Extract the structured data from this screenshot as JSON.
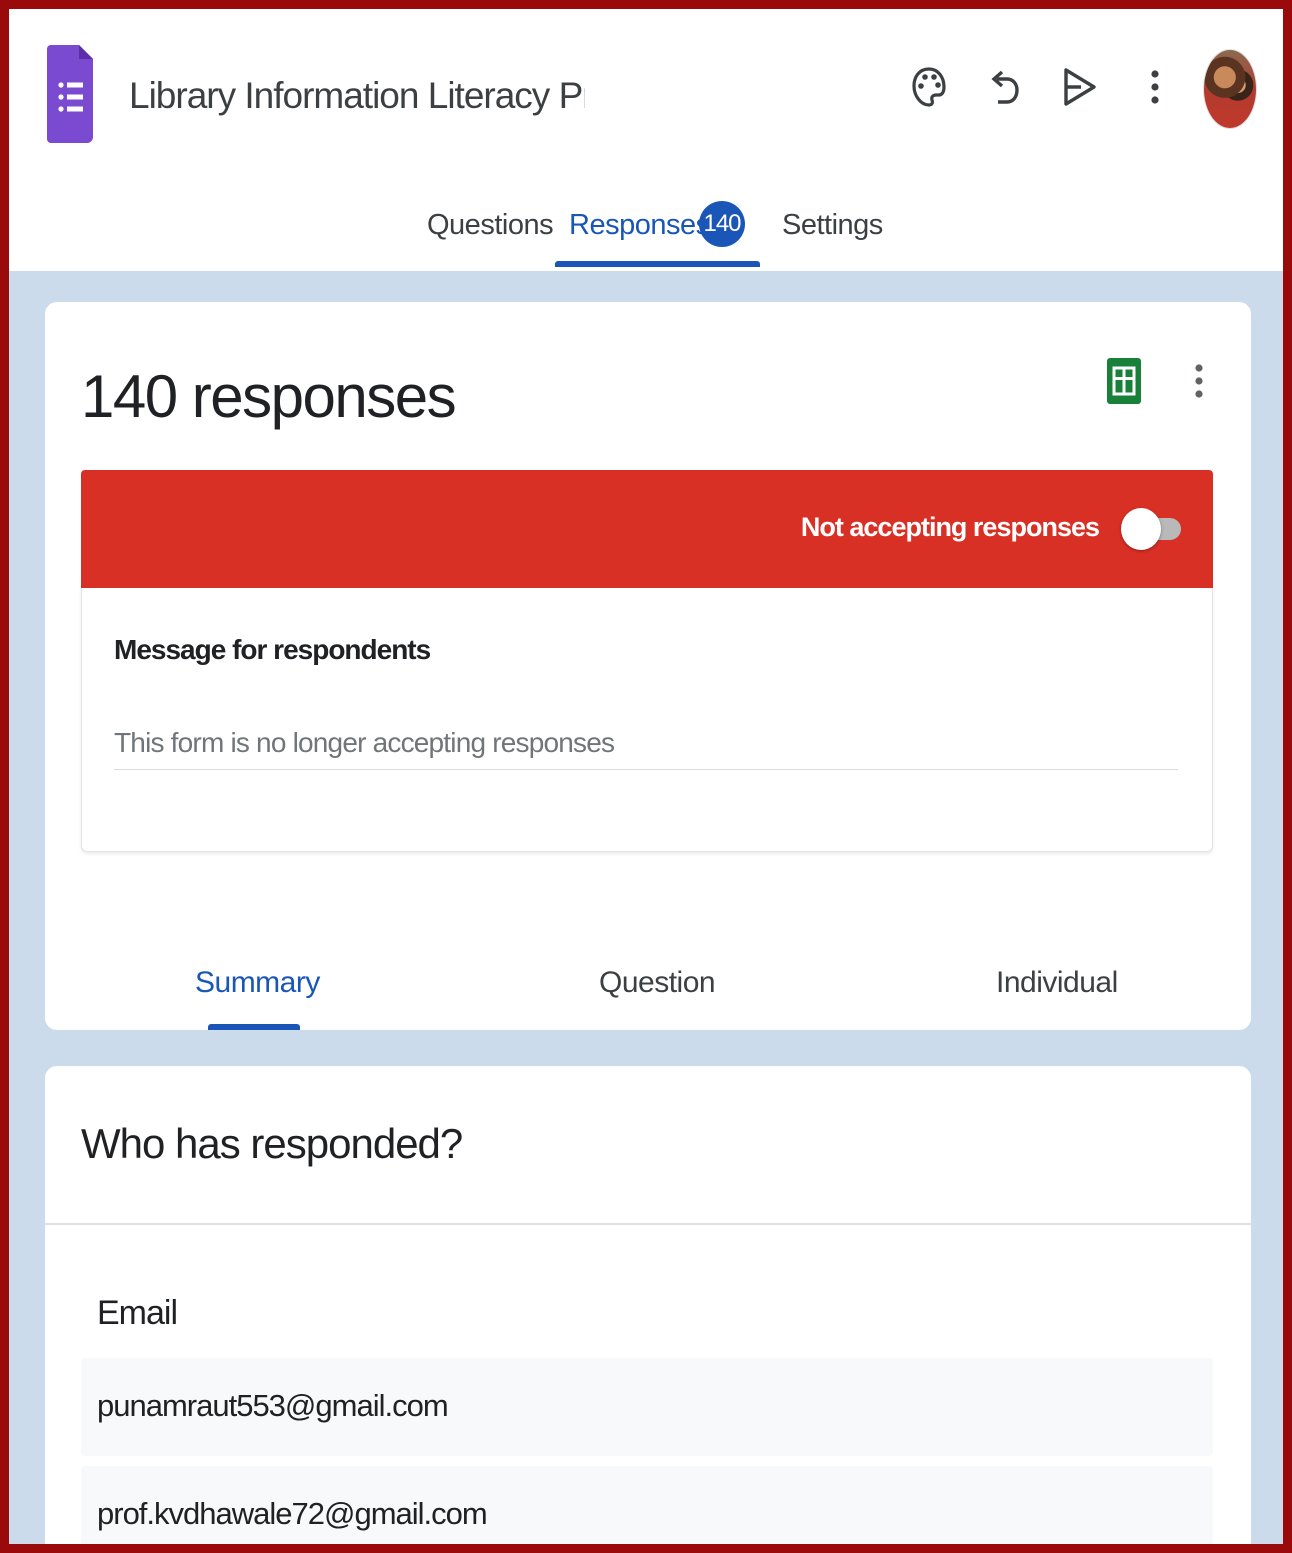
{
  "header": {
    "title": "Library Information Literacy Prograr",
    "icons": [
      "palette-icon",
      "undo-icon",
      "send-icon",
      "more-vert-icon"
    ],
    "tabs": [
      {
        "label": "Questions"
      },
      {
        "label": "Responses",
        "badge": "140"
      },
      {
        "label": "Settings"
      }
    ]
  },
  "responses": {
    "count_label": "140 responses",
    "banner": {
      "status_text": "Not accepting responses",
      "accepting": false
    },
    "message_label": "Message for respondents",
    "message_value": "This form is no longer accepting responses",
    "subtabs": [
      {
        "label": "Summary"
      },
      {
        "label": "Question"
      },
      {
        "label": "Individual"
      }
    ]
  },
  "who": {
    "title": "Who has responded?",
    "column_header": "Email",
    "emails": [
      "punamraut553@gmail.com",
      "prof.kvdhawale72@gmail.com"
    ]
  },
  "colors": {
    "accent": "#1a56b8",
    "banner_red": "#d93025",
    "forms_purple": "#7a4bd0",
    "sheets_green": "#188038",
    "frame_red": "#9b0a0a",
    "page_bg": "#ccdbeb"
  }
}
